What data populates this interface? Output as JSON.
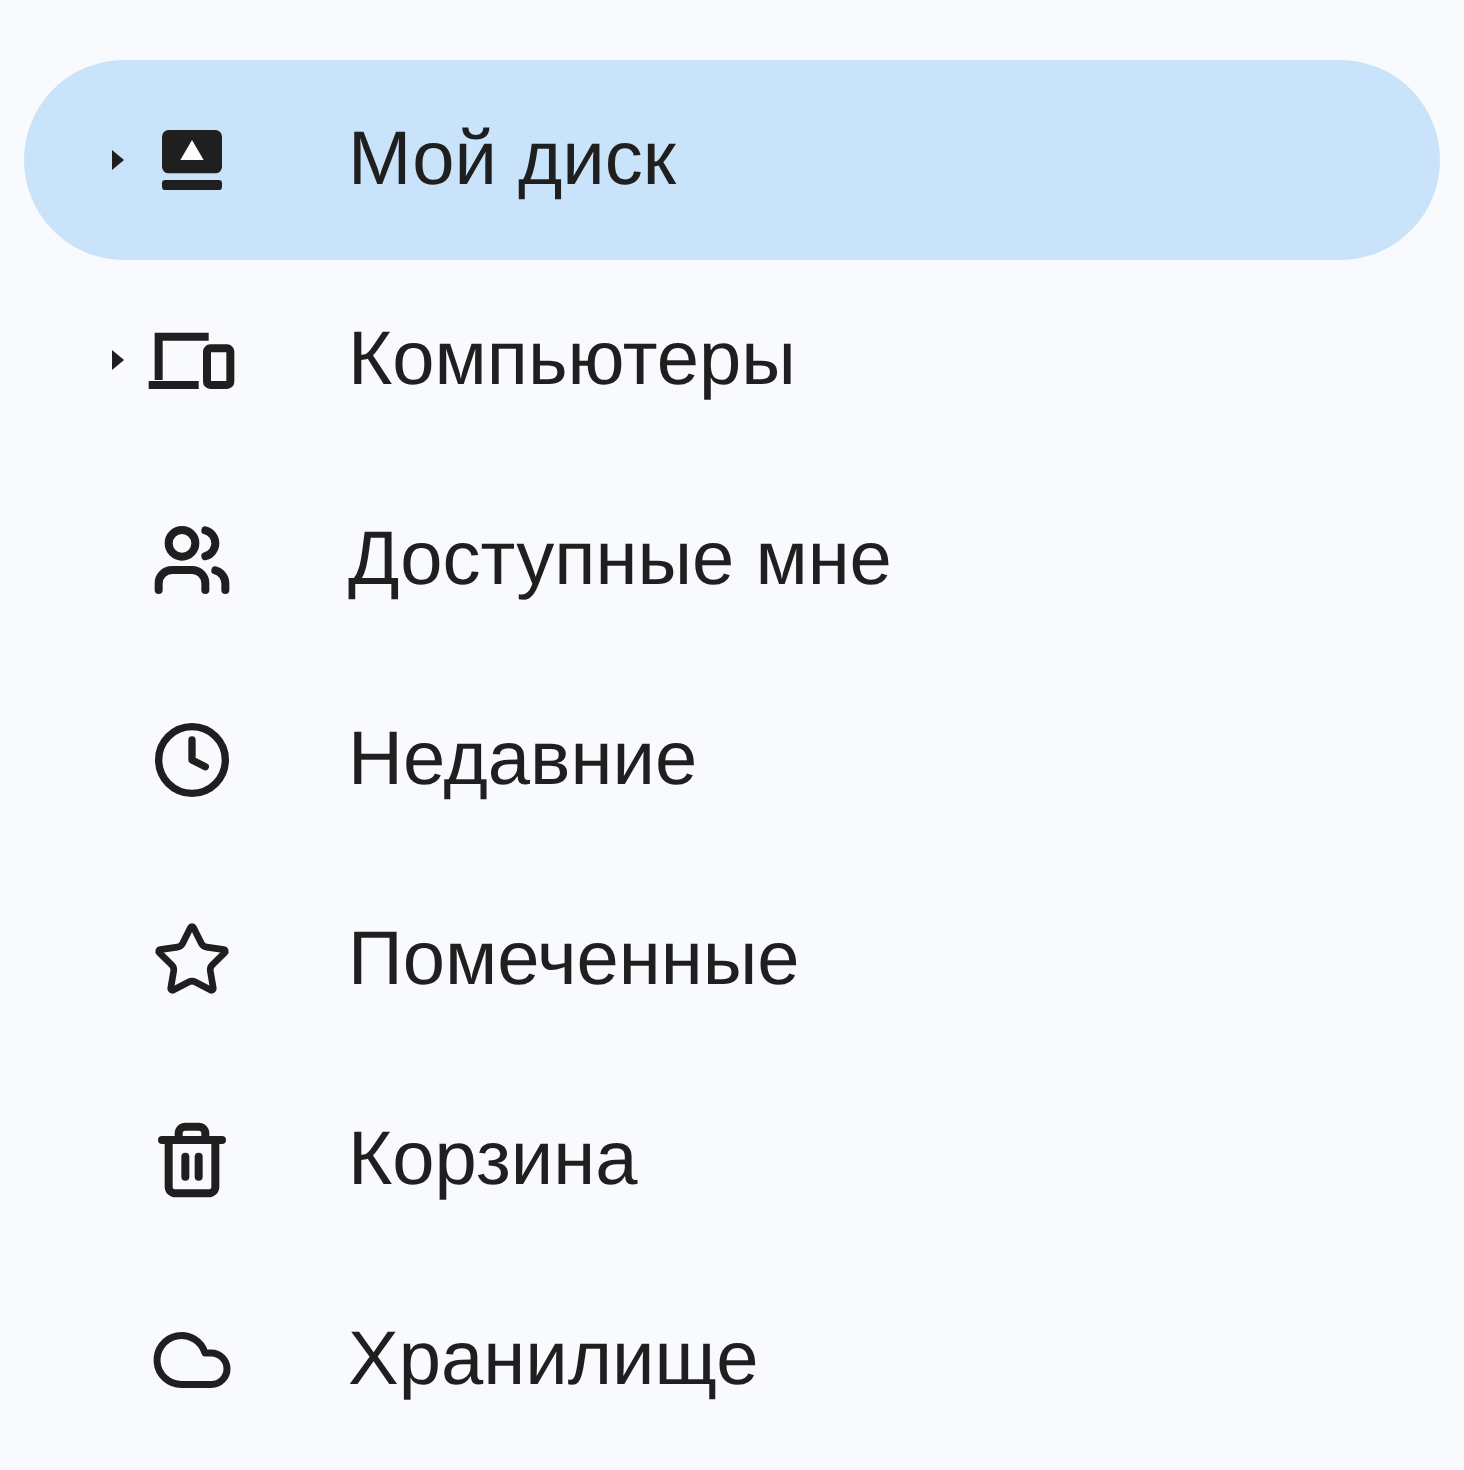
{
  "sidebar": {
    "items": [
      {
        "label": "Мой диск",
        "selected": true,
        "expandable": true
      },
      {
        "label": "Компьютеры",
        "selected": false,
        "expandable": true
      },
      {
        "label": "Доступные мне",
        "selected": false,
        "expandable": false
      },
      {
        "label": "Недавние",
        "selected": false,
        "expandable": false
      },
      {
        "label": "Помеченные",
        "selected": false,
        "expandable": false
      },
      {
        "label": "Корзина",
        "selected": false,
        "expandable": false
      },
      {
        "label": "Хранилище",
        "selected": false,
        "expandable": false
      }
    ]
  }
}
